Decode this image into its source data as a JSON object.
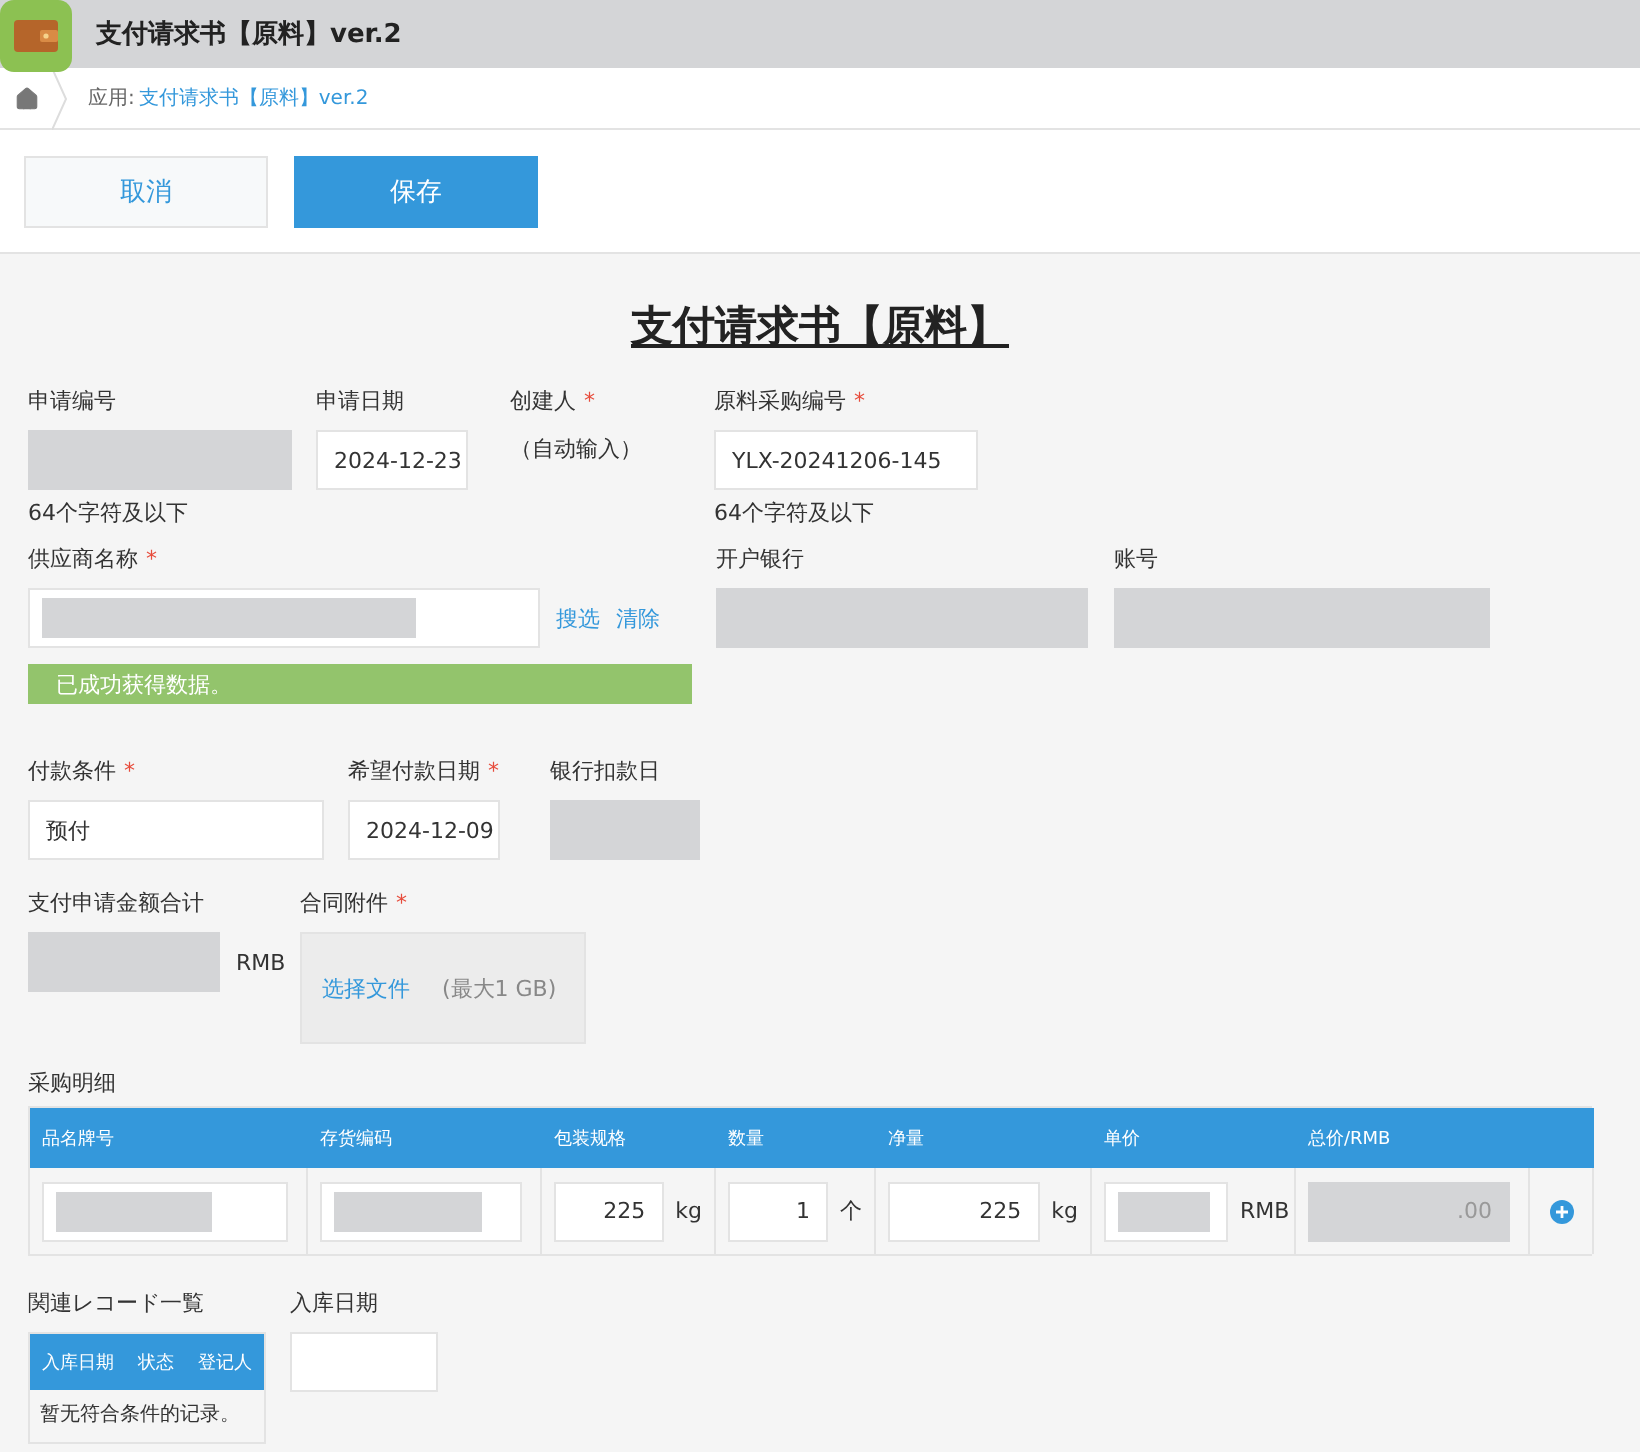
{
  "app": {
    "title": "支付请求书【原料】ver.2"
  },
  "breadcrumb": {
    "prefix": "应用:",
    "link": "支付请求书【原料】ver.2"
  },
  "toolbar": {
    "buttons": [
      {
        "label": "取消",
        "kind": "secondary"
      },
      {
        "label": "保存",
        "kind": "primary"
      }
    ]
  },
  "form": {
    "title": "支付请求书【原料】",
    "rows": [
      {
        "fields": [
          {
            "kind": "input",
            "label": "申请编号",
            "disabled": true,
            "note": "64个字符及以下"
          },
          {
            "kind": "input",
            "label": "申请日期",
            "disabled": false,
            "value": "2024-12-23"
          },
          {
            "kind": "text",
            "label": "创建人",
            "required_mark": "*",
            "value": "（自动输入）"
          },
          {
            "kind": "input",
            "label": "原料采购编号",
            "required_mark": "*",
            "disabled": false,
            "value": "YLX-20241206-145",
            "note": "64个字符及以下"
          }
        ]
      },
      {
        "fields": [
          {
            "kind": "input",
            "label": "供应商名称",
            "required_mark": "*",
            "disabled": false,
            "masked": true,
            "links": [
              "搜选",
              "清除"
            ]
          },
          {
            "kind": "input",
            "label": "开户银行",
            "disabled": true
          },
          {
            "kind": "input",
            "label": "账号",
            "disabled": true
          }
        ],
        "notice": "已成功获得数据。"
      },
      {
        "fields": [
          {
            "kind": "input",
            "label": "付款条件",
            "required_mark": "*",
            "disabled": false,
            "value": "预付"
          },
          {
            "kind": "input",
            "label": "希望付款日期",
            "required_mark": "*",
            "disabled": false,
            "value": "2024-12-09"
          },
          {
            "kind": "input",
            "label": "银行扣款日",
            "disabled": true
          }
        ]
      },
      {
        "fields": [
          {
            "kind": "input",
            "label": "支付申请金额合计",
            "disabled": true,
            "suffix": "RMB"
          },
          {
            "kind": "upload",
            "label": "合同附件",
            "required_mark": "*",
            "link": "选择文件",
            "hint": "(最大1 GB)"
          }
        ]
      }
    ]
  },
  "details": {
    "label": "采购明细",
    "columns": [
      "品名牌号",
      "存货编码",
      "包装规格",
      "数量",
      "净量",
      "单价",
      "总价/RMB"
    ],
    "rows": [
      {
        "cells": [
          {
            "disabled": false,
            "masked": true
          },
          {
            "disabled": false,
            "masked": true
          },
          {
            "disabled": false,
            "value": "225",
            "unit": "kg"
          },
          {
            "disabled": false,
            "value": "1",
            "unit": "个"
          },
          {
            "disabled": false,
            "value": "225",
            "unit": "kg"
          },
          {
            "disabled": false,
            "masked": true,
            "unit": "RMB"
          },
          {
            "disabled": true,
            "value": ".00"
          }
        ]
      }
    ]
  },
  "related": {
    "label": "関連レコード一覧",
    "columns": [
      "入库日期",
      "状态",
      "登记人"
    ],
    "empty": "暂无符合条件的记录。"
  },
  "stock_date": {
    "label": "入库日期"
  }
}
